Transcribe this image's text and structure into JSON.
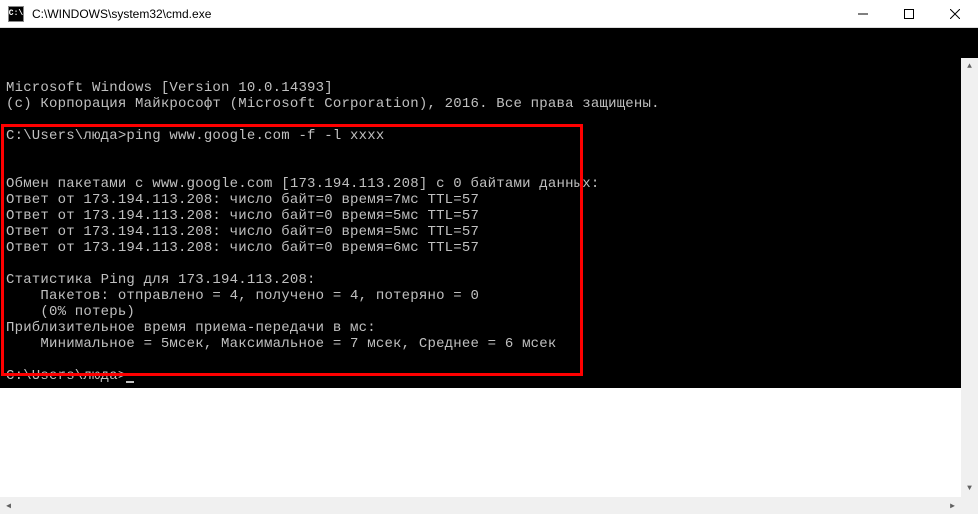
{
  "window": {
    "title": "C:\\WINDOWS\\system32\\cmd.exe",
    "icon_label": "C:\\"
  },
  "terminal": {
    "lines": [
      "Microsoft Windows [Version 10.0.14393]",
      "(c) Корпорация Майкрософт (Microsoft Corporation), 2016. Все права защищены.",
      "",
      "C:\\Users\\люда>ping www.google.com -f -l xxxx",
      "",
      "",
      "Обмен пакетами с www.google.com [173.194.113.208] с 0 байтами данных:",
      "Ответ от 173.194.113.208: число байт=0 время=7мс TTL=57",
      "Ответ от 173.194.113.208: число байт=0 время=5мс TTL=57",
      "Ответ от 173.194.113.208: число байт=0 время=5мс TTL=57",
      "Ответ от 173.194.113.208: число байт=0 время=6мс TTL=57",
      "",
      "Статистика Ping для 173.194.113.208:",
      "    Пакетов: отправлено = 4, получено = 4, потеряно = 0",
      "    (0% потерь)",
      "Приблизительное время приема-передачи в мс:",
      "    Минимальное = 5мсек, Максимальное = 7 мсек, Среднее = 6 мсек",
      "",
      "C:\\Users\\люда>"
    ]
  }
}
